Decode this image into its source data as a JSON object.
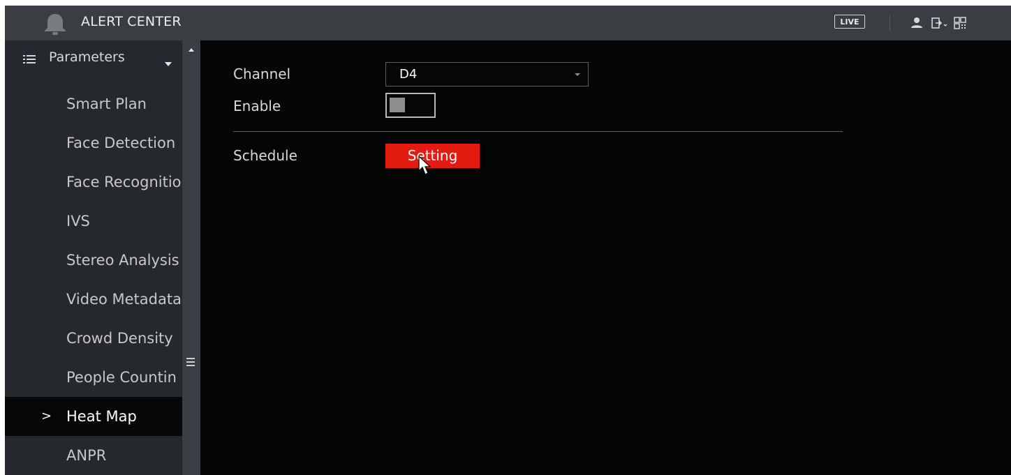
{
  "header": {
    "title": "ALERT CENTER",
    "live_label": "LIVE",
    "icons": [
      "bell-icon",
      "user-icon",
      "logout-icon",
      "qr-code-icon"
    ]
  },
  "sidebar": {
    "section_label": "Parameters",
    "items": [
      {
        "label": "Smart Plan"
      },
      {
        "label": "Face Detection"
      },
      {
        "label": "Face Recognitio"
      },
      {
        "label": "IVS"
      },
      {
        "label": "Stereo Analysis"
      },
      {
        "label": "Video Metadata"
      },
      {
        "label": "Crowd Density"
      },
      {
        "label": "People Countin"
      },
      {
        "label": "Heat Map",
        "active": true
      },
      {
        "label": "ANPR"
      }
    ],
    "active_marker": ">"
  },
  "form": {
    "channel_label": "Channel",
    "channel_value": "D4",
    "enable_label": "Enable",
    "enable_value": false,
    "schedule_label": "Schedule",
    "setting_button": "Setting"
  },
  "colors": {
    "accent": "#e31b10",
    "header_bg": "#3a3d42",
    "sidebar_bg": "#25282c",
    "main_bg": "#040606"
  }
}
